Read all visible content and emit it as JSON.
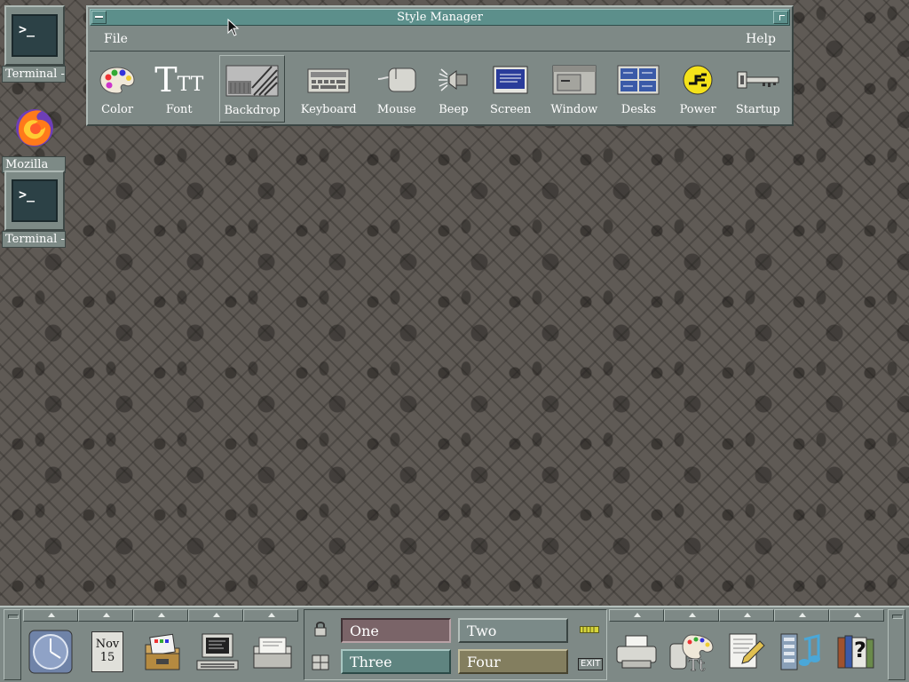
{
  "desktop": {
    "icons": [
      {
        "label": "Terminal -",
        "icon": "terminal-icon",
        "glyph": ">_"
      },
      {
        "label": "Mozilla",
        "icon": "firefox-icon"
      },
      {
        "label": "Terminal -",
        "icon": "terminal-icon",
        "glyph": ">_"
      }
    ]
  },
  "window": {
    "title": "Style Manager",
    "menu": {
      "file": "File",
      "help": "Help"
    },
    "tools": [
      {
        "label": "Color",
        "icon": "palette-icon"
      },
      {
        "label": "Font",
        "icon": "font-icon",
        "glyph_big": "T",
        "glyph_small": "TT"
      },
      {
        "label": "Backdrop",
        "icon": "backdrop-icon"
      },
      {
        "label": "Keyboard",
        "icon": "keyboard-icon"
      },
      {
        "label": "Mouse",
        "icon": "mouse-icon"
      },
      {
        "label": "Beep",
        "icon": "speaker-icon"
      },
      {
        "label": "Screen",
        "icon": "screen-icon"
      },
      {
        "label": "Window",
        "icon": "window-icon"
      },
      {
        "label": "Desks",
        "icon": "desks-icon"
      },
      {
        "label": "Power",
        "icon": "power-plug-icon"
      },
      {
        "label": "Startup",
        "icon": "key-icon"
      }
    ]
  },
  "panel": {
    "calendar": {
      "month": "Nov",
      "day": "15"
    },
    "workspaces": {
      "one": "One",
      "two": "Two",
      "three": "Three",
      "four": "Four"
    },
    "exit_label": "EXIT",
    "help_glyph": "?"
  },
  "colors": {
    "window_bg": "#7e8986",
    "titlebar": "#5c8f8b",
    "ws_one": "#7a6468",
    "ws_two": "#7b8a88",
    "ws_three": "#5f8480",
    "ws_four": "#837e5f",
    "power_yellow": "#f5e21a"
  }
}
